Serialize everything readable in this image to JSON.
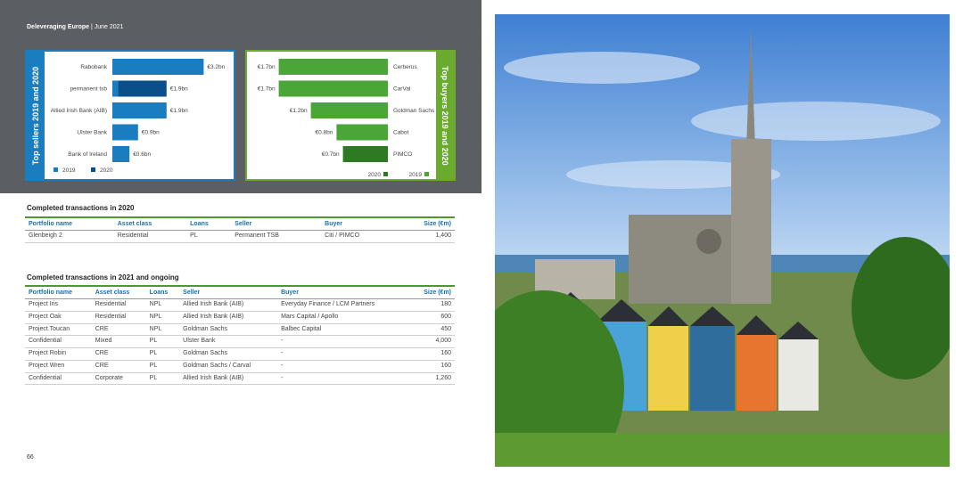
{
  "header": {
    "title": "Deleveraging Europe",
    "separator": " | ",
    "date": "June 2021"
  },
  "sellers_chart": {
    "side_label": "Top sellers 2019 and 2020",
    "legend": [
      "2019",
      "2020"
    ]
  },
  "buyers_chart": {
    "side_label": "Top buyers 2019 and 2020",
    "legend": [
      "2020",
      "2019"
    ]
  },
  "chart_data": [
    {
      "type": "bar",
      "orientation": "horizontal",
      "categories": [
        "Rabobank",
        "permanent tsb",
        "Allied Irish Bank (AIB)",
        "Ulster Bank",
        "Bank of Ireland"
      ],
      "series": [
        {
          "name": "2019",
          "values": [
            3.2,
            0.2,
            1.9,
            0.9,
            0.6
          ]
        },
        {
          "name": "2020",
          "values": [
            0,
            1.7,
            0,
            0,
            0
          ]
        }
      ],
      "data_labels": [
        "€3.2bn",
        "€1.9bn",
        "€1.9bn",
        "€0.9bn",
        "€0.6bn"
      ],
      "colors": {
        "2019": "#1a7dc0",
        "2020": "#0b4f8a"
      },
      "legend": "bottom-left"
    },
    {
      "type": "bar",
      "orientation": "horizontal",
      "categories": [
        "Cerberus",
        "CarVal",
        "Goldman Sachs",
        "Cabot",
        "PIMCO"
      ],
      "series": [
        {
          "name": "2019",
          "values": [
            1.7,
            1.7,
            1.2,
            0.8,
            0.0
          ]
        },
        {
          "name": "2020",
          "values": [
            0,
            0,
            0,
            0,
            0.7
          ]
        }
      ],
      "data_labels": [
        "€1.7bn",
        "€1.7bn",
        "€1.2bn",
        "€0.8bn",
        "€0.7bn"
      ],
      "colors": {
        "2019": "#4aa636",
        "2020": "#2d7a22"
      },
      "legend": "bottom-right"
    }
  ],
  "table2020": {
    "title": "Completed transactions in 2020",
    "headers": [
      "Portfolio name",
      "Asset class",
      "Loans",
      "Seller",
      "Buyer",
      "Size (€m)"
    ],
    "rows": [
      [
        "Glenbeigh 2",
        "Residential",
        "PL",
        "Permanent TSB",
        "Citi / PIMCO",
        "1,400"
      ]
    ]
  },
  "table2021": {
    "title": "Completed transactions in 2021 and ongoing",
    "headers": [
      "Portfolio name",
      "Asset class",
      "Loans",
      "Seller",
      "Buyer",
      "Size (€m)"
    ],
    "rows": [
      [
        "Project Iris",
        "Residential",
        "NPL",
        "Allied Irish Bank (AIB)",
        "Everyday Finance / LCM Partners",
        "180"
      ],
      [
        "Project Oak",
        "Residential",
        "NPL",
        "Allied Irish Bank (AIB)",
        "Mars Capital / Apollo",
        "600"
      ],
      [
        "Project Toucan",
        "CRE",
        "NPL",
        "Goldman Sachs",
        "Balbec Capital",
        "450"
      ],
      [
        "Confidential",
        "Mixed",
        "PL",
        "Ulster Bank",
        "-",
        "4,000"
      ],
      [
        "Project Robin",
        "CRE",
        "PL",
        "Goldman Sachs",
        "-",
        "160"
      ],
      [
        "Project Wren",
        "CRE",
        "PL",
        "Goldman Sachs / Carval",
        "-",
        "160"
      ],
      [
        "Confidential",
        "Corporate",
        "PL",
        "Allied Irish Bank (AIB)",
        "-",
        "1,260"
      ]
    ]
  },
  "footer": {
    "page_number": "66"
  }
}
